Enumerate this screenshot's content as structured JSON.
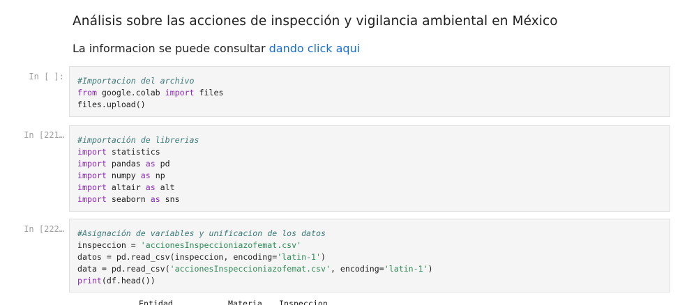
{
  "markdown": {
    "title": "Análisis sobre las acciones de inspección y vigilancia ambiental en México",
    "subtitle_text": "La informacion se puede consultar ",
    "subtitle_link": "dando click aqui"
  },
  "cells": [
    {
      "prompt": "In [ ]:",
      "lines": [
        [
          {
            "t": "cm",
            "v": "#Importacion del archivo"
          }
        ],
        [
          {
            "t": "kw",
            "v": "from"
          },
          {
            "t": "",
            "v": " google.colab "
          },
          {
            "t": "kw",
            "v": "import"
          },
          {
            "t": "",
            "v": " files"
          }
        ],
        [
          {
            "t": "",
            "v": "files.upload()"
          }
        ]
      ]
    },
    {
      "prompt": "In [221…",
      "lines": [
        [
          {
            "t": "cm",
            "v": "#importación de librerias"
          }
        ],
        [
          {
            "t": "kw",
            "v": "import"
          },
          {
            "t": "",
            "v": " statistics"
          }
        ],
        [
          {
            "t": "kw",
            "v": "import"
          },
          {
            "t": "",
            "v": " pandas "
          },
          {
            "t": "kw",
            "v": "as"
          },
          {
            "t": "",
            "v": " pd"
          }
        ],
        [
          {
            "t": "kw",
            "v": "import"
          },
          {
            "t": "",
            "v": " numpy "
          },
          {
            "t": "kw",
            "v": "as"
          },
          {
            "t": "",
            "v": " np"
          }
        ],
        [
          {
            "t": "kw",
            "v": "import"
          },
          {
            "t": "",
            "v": " altair "
          },
          {
            "t": "kw",
            "v": "as"
          },
          {
            "t": "",
            "v": " alt"
          }
        ],
        [
          {
            "t": "kw",
            "v": "import"
          },
          {
            "t": "",
            "v": " seaborn "
          },
          {
            "t": "kw",
            "v": "as"
          },
          {
            "t": "",
            "v": " sns"
          }
        ]
      ]
    },
    {
      "prompt": "In [222…",
      "lines": [
        [
          {
            "t": "cm",
            "v": "#Asignación de variables y unificacion de los datos"
          }
        ],
        [
          {
            "t": "",
            "v": "inspeccion = "
          },
          {
            "t": "st",
            "v": "'accionesInspeccioniazofemat.csv'"
          }
        ],
        [
          {
            "t": "",
            "v": "datos = pd.read_csv(inspeccion, encoding="
          },
          {
            "t": "st",
            "v": "'latin-1'"
          },
          {
            "t": "",
            "v": ")"
          }
        ],
        [
          {
            "t": "",
            "v": "data = pd.read_csv("
          },
          {
            "t": "st",
            "v": "'accionesInspeccioniazofemat.csv'"
          },
          {
            "t": "",
            "v": ", encoding="
          },
          {
            "t": "st",
            "v": "'latin-1'"
          },
          {
            "t": "",
            "v": ")"
          }
        ],
        [
          {
            "t": "fn",
            "v": "print"
          },
          {
            "t": "",
            "v": "(df.head())"
          }
        ]
      ]
    }
  ],
  "output_header": [
    "Entidad",
    "Materia",
    "Inspeccion"
  ]
}
